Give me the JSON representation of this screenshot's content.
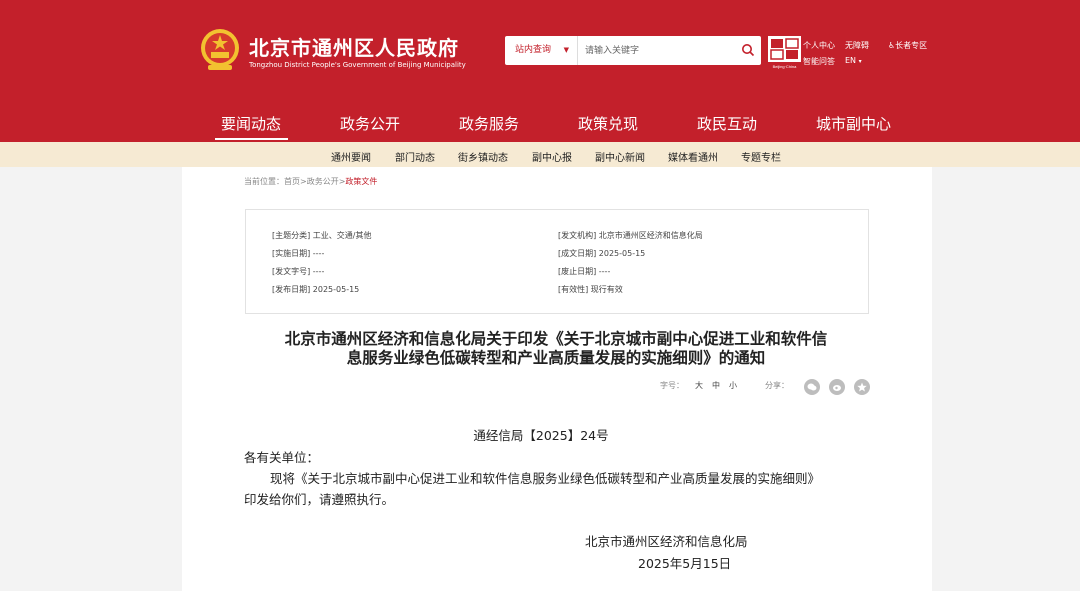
{
  "header": {
    "title": "北京市通州区人民政府",
    "subtitle": "Tongzhou District People's Government of Beijing Municipality",
    "search": {
      "scope_label": "站内查询",
      "placeholder": "请输入关键字"
    },
    "capital_logo_text": "Beijing·China",
    "links": {
      "personal_center": "个人中心",
      "smart_qa": "智能问答",
      "accessibility": "无障碍",
      "english": "EN",
      "elderly": "长者专区"
    }
  },
  "nav": {
    "items": [
      "要闻动态",
      "政务公开",
      "政务服务",
      "政策兑现",
      "政民互动",
      "城市副中心"
    ],
    "active": "要闻动态"
  },
  "subnav": {
    "items": [
      "通州要闻",
      "部门动态",
      "街乡镇动态",
      "副中心报",
      "副中心新闻",
      "媒体看通州",
      "专题专栏"
    ]
  },
  "breadcrumb": {
    "prefix": "当前位置：",
    "items": [
      "首页",
      "政务公开",
      "政策文件"
    ],
    "separator": ">"
  },
  "meta": {
    "topic": "[主题分类] 工业、交通/其他",
    "issuer": "[发文机构] 北京市通州区经济和信息化局",
    "effective_date": "[实施日期] ----",
    "written_date": "[成文日期] 2025-05-15",
    "doc_number": "[发文字号] ----",
    "repeal_date": "[废止日期] ----",
    "publish_date": "[发布日期] 2025-05-15",
    "validity": "[有效性] 现行有效"
  },
  "document": {
    "title_line1": "北京市通州区经济和信息化局关于印发《关于北京城市副中心促进工业和软件信",
    "title_line2": "息服务业绿色低碳转型和产业高质量发展的实施细则》的通知",
    "font_size_label": "字号：",
    "font_sizes": [
      "大",
      "中",
      "小"
    ],
    "share_label": "分享：",
    "share_icons": [
      "wechat-icon",
      "weibo-icon",
      "favorite-icon"
    ],
    "doc_no": "通经信局【2025】24号",
    "salutation": "各有关单位：",
    "body_line1": "现将《关于北京城市副中心促进工业和软件信息服务业绿色低碳转型和产业高质量发展的实施细则》",
    "body_line2": "印发给你们，请遵照执行。",
    "signature": "北京市通州区经济和信息化局",
    "date": "2025年5月15日"
  },
  "colors": {
    "brand_red": "#c3202b",
    "subnav_bg": "#f6ead3"
  }
}
